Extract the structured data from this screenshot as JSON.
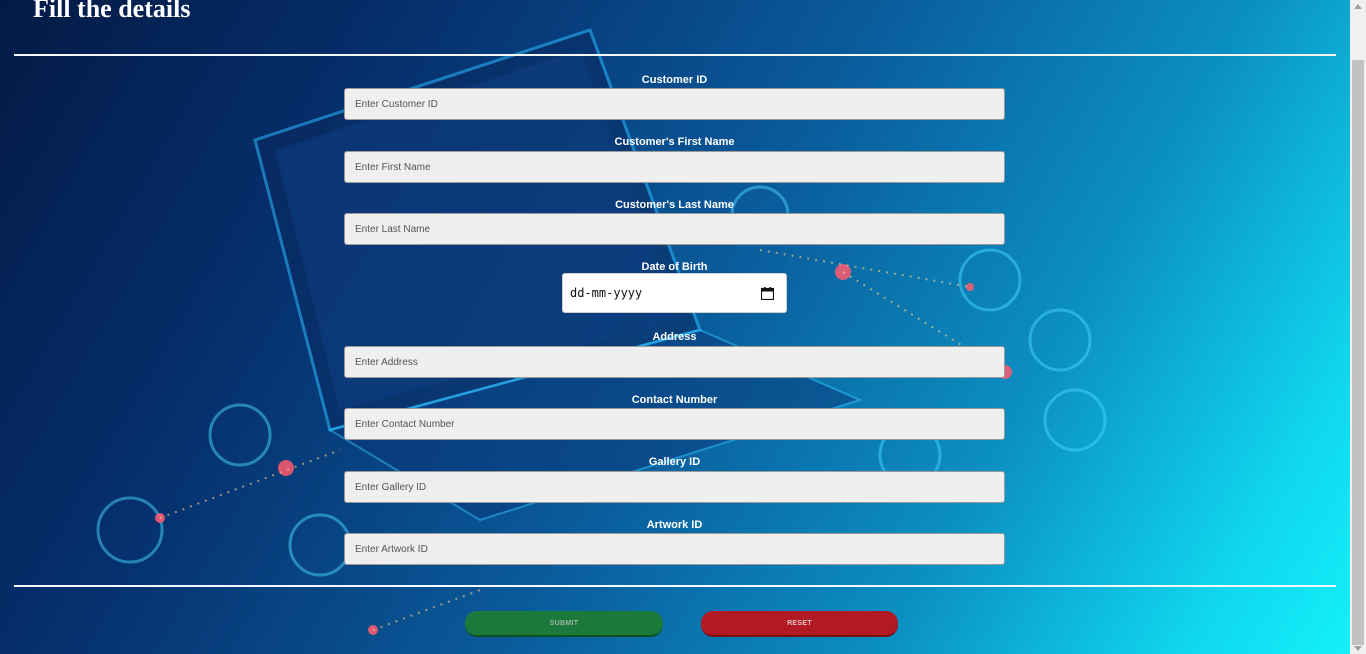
{
  "form": {
    "title": "Fill the details",
    "fields": [
      {
        "label": "Customer ID",
        "placeholder": "Enter Customer ID"
      },
      {
        "label": "Customer's First Name",
        "placeholder": "Enter First Name"
      },
      {
        "label": "Customer's Last Name",
        "placeholder": "Enter Last Name"
      },
      {
        "label": "Date of Birth",
        "value": "dd-mm-yyyy"
      },
      {
        "label": "Address",
        "placeholder": "Enter Address"
      },
      {
        "label": "Contact Number",
        "placeholder": "Enter Contact Number"
      },
      {
        "label": "Gallery ID",
        "placeholder": "Enter Gallery ID"
      },
      {
        "label": "Artwork ID",
        "placeholder": "Enter Artwork ID"
      }
    ],
    "submit_label": "SUBMIT",
    "reset_label": "RESET"
  },
  "colors": {
    "submit": "#1b7a3b",
    "reset": "#b11a22",
    "background_dark": "#031a45",
    "background_light": "#14f3fb"
  },
  "icons": [
    "calendar-icon"
  ]
}
